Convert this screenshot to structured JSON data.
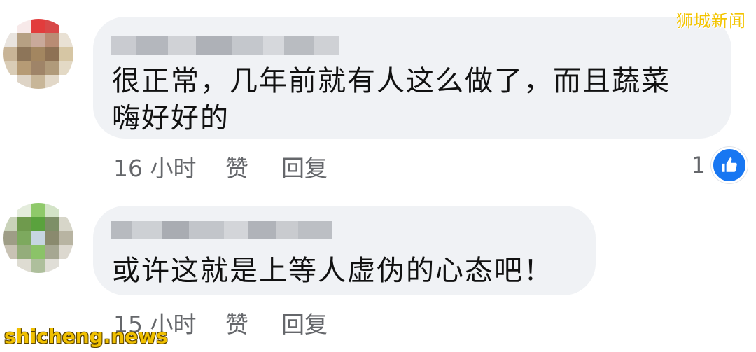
{
  "watermarks": {
    "top_right": "狮城新闻",
    "bottom_left": "shicheng.news"
  },
  "colors": {
    "bubble_bg": "#f0f2f5",
    "meta_text": "#65676b",
    "like_badge": "#1877f2"
  },
  "comments": [
    {
      "author": "",
      "author_blurred": true,
      "text": "很正常，几年前就有人这么做了，而且蔬菜\n嗨好好的",
      "time": "16 小时",
      "like_label": "赞",
      "reply_label": "回复",
      "reaction_count": "1",
      "reaction_icon": "thumbs-up-icon"
    },
    {
      "author": "",
      "author_blurred": true,
      "text": "或许这就是上等人虚伪的心态吧！",
      "time": "15 小时",
      "like_label": "赞",
      "reply_label": "回复"
    }
  ]
}
